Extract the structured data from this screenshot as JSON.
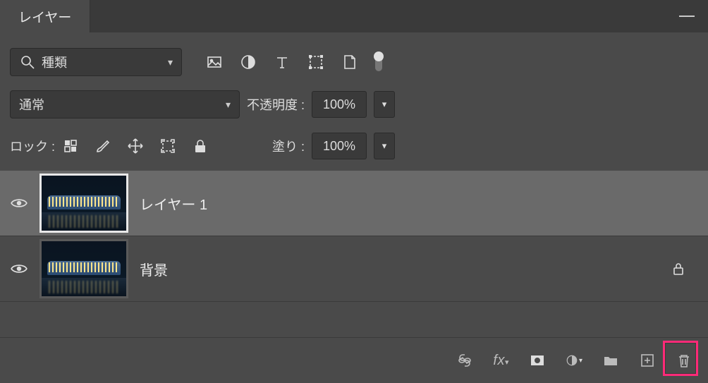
{
  "panel": {
    "title": "レイヤー"
  },
  "filter": {
    "search_label": "種類",
    "blend_mode": "通常",
    "opacity_label": "不透明度 :",
    "opacity_value": "100%",
    "lock_label": "ロック :",
    "fill_label": "塗り :",
    "fill_value": "100%"
  },
  "layers": [
    {
      "name": "レイヤー 1",
      "selected": true,
      "locked": false,
      "visible": true
    },
    {
      "name": "背景",
      "selected": false,
      "locked": true,
      "visible": true
    }
  ],
  "icons": {
    "image": "image-icon",
    "adjust": "adjustment-icon",
    "type": "type-icon",
    "shape": "shape-icon",
    "smart": "smartobject-icon",
    "pixels": "pixels-lock-icon",
    "brush": "brush-lock-icon",
    "move": "move-lock-icon",
    "artboard": "artboard-lock-icon",
    "lockall": "lock-all-icon",
    "link": "link-icon",
    "fx": "fx-icon",
    "mask": "mask-icon",
    "fill_adj": "new-adjustment-icon",
    "group": "new-group-icon",
    "new": "new-layer-icon",
    "trash": "trash-icon"
  }
}
